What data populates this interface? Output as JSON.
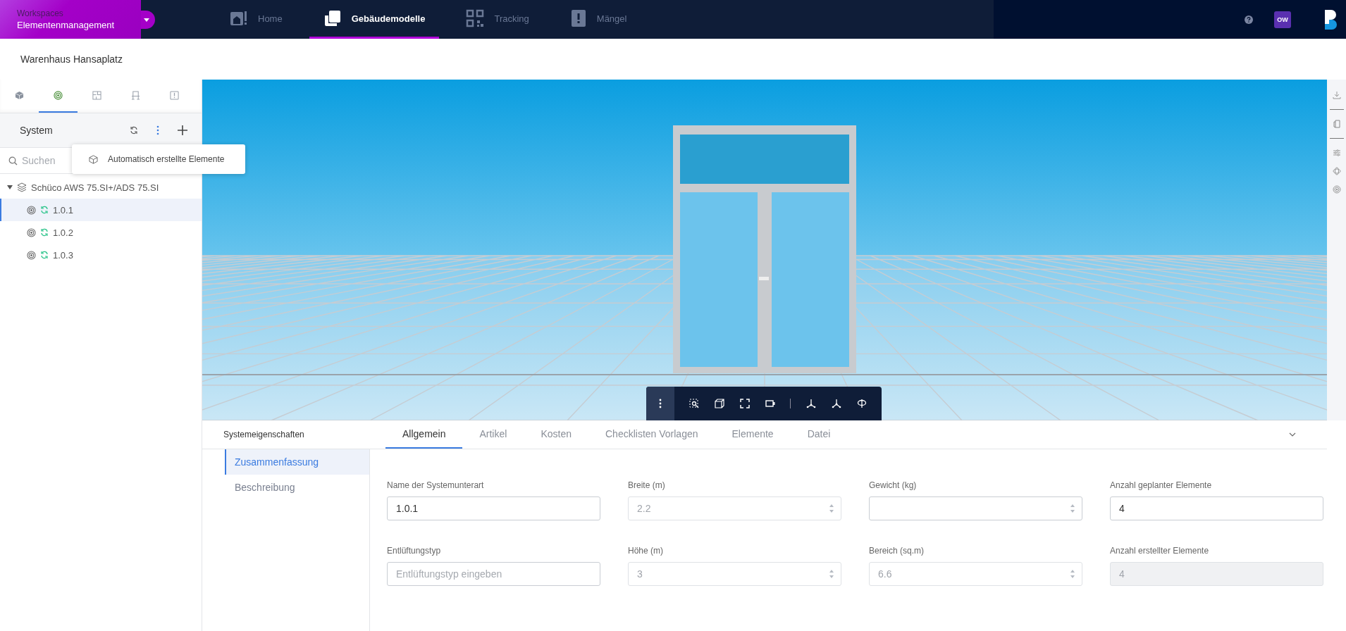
{
  "workspace": {
    "caption": "Workspaces",
    "name": "Elementenmanagement"
  },
  "nav": [
    {
      "label": "Home",
      "selected": false
    },
    {
      "label": "Gebäudemodelle",
      "selected": true
    },
    {
      "label": "Tracking",
      "selected": false
    },
    {
      "label": "Mängel",
      "selected": false
    }
  ],
  "user": {
    "initials": "OW"
  },
  "project": {
    "title": "Warenhaus Hansaplatz"
  },
  "sidebar": {
    "tabs": [
      {
        "selected": false
      },
      {
        "selected": true
      },
      {
        "selected": false
      },
      {
        "selected": false
      },
      {
        "selected": false
      }
    ],
    "title": "System",
    "search": {
      "placeholder": "Suchen"
    },
    "tree": [
      {
        "label": "Schüco AWS 75.SI+/ADS 75.SI",
        "expanded": true,
        "children": [
          {
            "label": "1.0.1",
            "selected": true
          },
          {
            "label": "1.0.2",
            "selected": false
          },
          {
            "label": "1.0.3",
            "selected": false
          }
        ]
      }
    ]
  },
  "menu": {
    "items": [
      {
        "label": "Automatisch erstellte Elemente"
      }
    ]
  },
  "properties": {
    "title": "Systemeigenschaften",
    "tabs": [
      {
        "label": "Allgemein",
        "selected": true
      },
      {
        "label": "Artikel",
        "selected": false
      },
      {
        "label": "Kosten",
        "selected": false
      },
      {
        "label": "Checklisten Vorlagen",
        "selected": false
      },
      {
        "label": "Elemente",
        "selected": false
      },
      {
        "label": "Datei",
        "selected": false
      }
    ],
    "sections": [
      {
        "label": "Zusammenfassung",
        "selected": true
      },
      {
        "label": "Beschreibung",
        "selected": false
      }
    ],
    "fields": [
      {
        "label": "Name der Systemunterart",
        "kind": "text",
        "value": "1.0.1",
        "disabled": false
      },
      {
        "label": "Breite (m)",
        "kind": "number",
        "value": "2.2",
        "disabled": true
      },
      {
        "label": "Gewicht (kg)",
        "kind": "number",
        "disabled": false
      },
      {
        "label": "Anzahl geplanter Elemente",
        "kind": "text",
        "value": "4",
        "disabled": false
      },
      {
        "label": "Entlüftungstyp",
        "kind": "text",
        "placeholder": "Entlüftungstyp eingeben",
        "disabled": false
      },
      {
        "label": "Höhe (m)",
        "kind": "number",
        "value": "3",
        "disabled": true
      },
      {
        "label": "Bereich (sq.m)",
        "kind": "number",
        "value": "6.6",
        "disabled": true
      },
      {
        "label": "Anzahl erstellter Elemente",
        "kind": "readonly",
        "value": "4",
        "disabled": true
      }
    ]
  }
}
